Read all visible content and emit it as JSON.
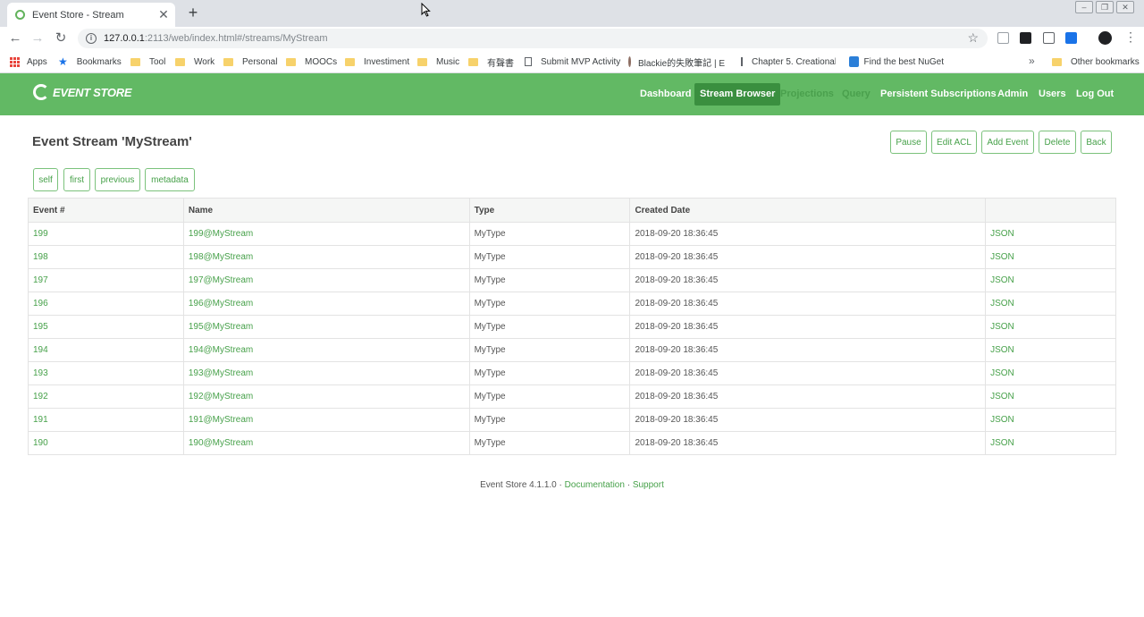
{
  "browser": {
    "tab_title": "Event Store - Stream",
    "url_host": "127.0.0.1",
    "url_rest": ":2113/web/index.html#/streams/MyStream",
    "bookmarks": [
      "Apps",
      "Bookmarks",
      "Tool",
      "Work",
      "Personal",
      "MOOCs",
      "Investiment",
      "Music",
      "有聲書",
      "Submit MVP Activity",
      "Blackie的失敗筆記 | E",
      "Chapter 5. Creational",
      "Find the best NuGet",
      "Other bookmarks"
    ]
  },
  "header": {
    "logo": "EVENT STORE",
    "nav": [
      "Dashboard",
      "Stream Browser",
      "Projections",
      "Query",
      "Persistent Subscriptions",
      "Admin",
      "Users",
      "Log Out"
    ]
  },
  "page": {
    "title": "Event Stream 'MyStream'",
    "actions": [
      "Pause",
      "Edit ACL",
      "Add Event",
      "Delete",
      "Back"
    ],
    "paging": [
      "self",
      "first",
      "previous",
      "metadata"
    ]
  },
  "table": {
    "columns": [
      "Event #",
      "Name",
      "Type",
      "Created Date",
      ""
    ],
    "rows": [
      [
        "199",
        "199@MyStream",
        "MyType",
        "2018-09-20 18:36:45",
        "JSON"
      ],
      [
        "198",
        "198@MyStream",
        "MyType",
        "2018-09-20 18:36:45",
        "JSON"
      ],
      [
        "197",
        "197@MyStream",
        "MyType",
        "2018-09-20 18:36:45",
        "JSON"
      ],
      [
        "196",
        "196@MyStream",
        "MyType",
        "2018-09-20 18:36:45",
        "JSON"
      ],
      [
        "195",
        "195@MyStream",
        "MyType",
        "2018-09-20 18:36:45",
        "JSON"
      ],
      [
        "194",
        "194@MyStream",
        "MyType",
        "2018-09-20 18:36:45",
        "JSON"
      ],
      [
        "193",
        "193@MyStream",
        "MyType",
        "2018-09-20 18:36:45",
        "JSON"
      ],
      [
        "192",
        "192@MyStream",
        "MyType",
        "2018-09-20 18:36:45",
        "JSON"
      ],
      [
        "191",
        "191@MyStream",
        "MyType",
        "2018-09-20 18:36:45",
        "JSON"
      ],
      [
        "190",
        "190@MyStream",
        "MyType",
        "2018-09-20 18:36:45",
        "JSON"
      ]
    ]
  },
  "footer": {
    "version": "Event Store 4.1.1.0",
    "sep": "·",
    "docs": "Documentation",
    "support": "Support"
  },
  "colors": {
    "brand_green": "#62b964",
    "active_nav": "#3a8f3f",
    "link_green": "#47a14a"
  }
}
